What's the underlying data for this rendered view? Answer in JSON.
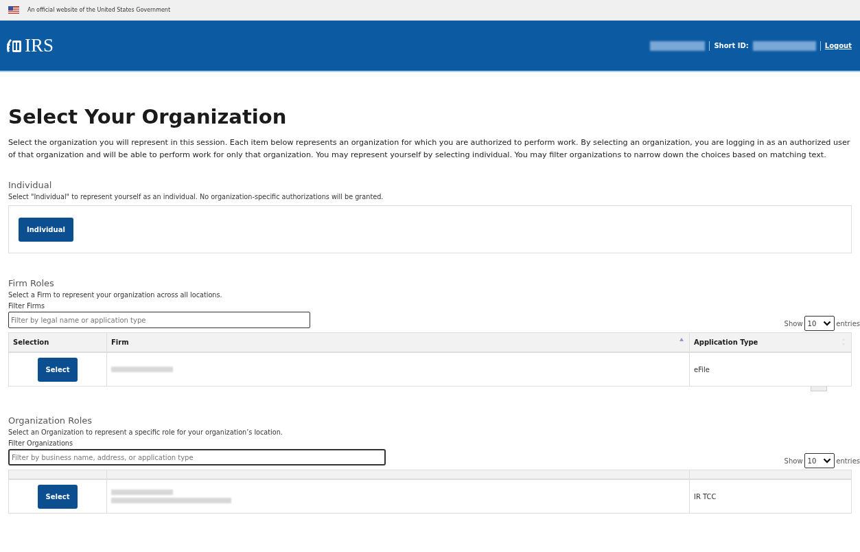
{
  "banner": {
    "text": "An official website of the United States Government"
  },
  "header": {
    "logo_text": "IRS",
    "short_id_label": "Short ID:",
    "logout": "Logout"
  },
  "page_title": "Select Your Organization",
  "intro": "Select the organization you will represent in this session. Each item below represents an organization for which you are authorized to perform work. By selecting an organization, you are logging in as an authorized user of that organization and will be able to perform work for only that organization. You may represent yourself by selecting individual. You may filter organizations to narrow down the choices based on matching text.",
  "individual": {
    "heading": "Individual",
    "description": "Select \"Individual\" to represent yourself as an individual. No organization-specific authorizations will be granted.",
    "button": "Individual"
  },
  "sections": [
    {
      "heading": "Firm Roles",
      "description": "Select a Firm to represent your organization across all locations.",
      "filter_label": "Filter Firms",
      "filter_placeholder": "Filter by legal name or application type",
      "show_label": "Show",
      "page_size": "10",
      "entries_label": "entries",
      "columns": [
        {
          "label": "Selection"
        },
        {
          "label": "Firm",
          "sorted": true
        },
        {
          "label": "Application Type",
          "sorted": false
        }
      ],
      "rows": [
        {
          "button": "Select",
          "application_type": "eFile"
        }
      ],
      "scroll_mark": true
    },
    {
      "heading": "Organization Roles",
      "description": "Select an Organization to represent a specific role for your organization’s location.",
      "filter_label": "Filter Organizations",
      "filter_placeholder": "Filter by business name, address, or application type",
      "show_label": "Show",
      "page_size": "10",
      "entries_label": "entries",
      "rows": [
        {
          "button": "Select",
          "application_type": "IR TCC"
        }
      ]
    }
  ]
}
